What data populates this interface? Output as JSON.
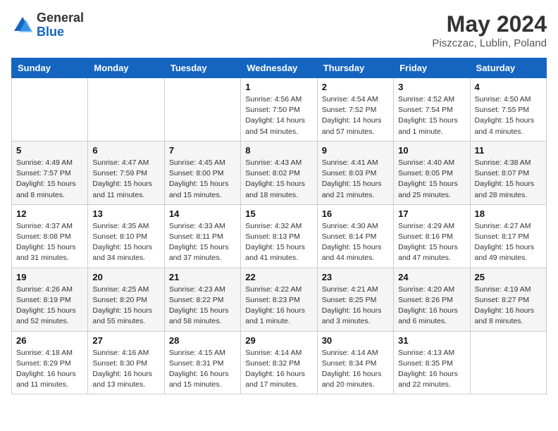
{
  "header": {
    "logo_general": "General",
    "logo_blue": "Blue",
    "month_year": "May 2024",
    "location": "Piszczac, Lublin, Poland"
  },
  "weekdays": [
    "Sunday",
    "Monday",
    "Tuesday",
    "Wednesday",
    "Thursday",
    "Friday",
    "Saturday"
  ],
  "weeks": [
    [
      null,
      null,
      null,
      {
        "day": 1,
        "sunrise": "4:56 AM",
        "sunset": "7:50 PM",
        "daylight": "14 hours and 54 minutes."
      },
      {
        "day": 2,
        "sunrise": "4:54 AM",
        "sunset": "7:52 PM",
        "daylight": "14 hours and 57 minutes."
      },
      {
        "day": 3,
        "sunrise": "4:52 AM",
        "sunset": "7:54 PM",
        "daylight": "15 hours and 1 minute."
      },
      {
        "day": 4,
        "sunrise": "4:50 AM",
        "sunset": "7:55 PM",
        "daylight": "15 hours and 4 minutes."
      }
    ],
    [
      {
        "day": 5,
        "sunrise": "4:49 AM",
        "sunset": "7:57 PM",
        "daylight": "15 hours and 8 minutes."
      },
      {
        "day": 6,
        "sunrise": "4:47 AM",
        "sunset": "7:59 PM",
        "daylight": "15 hours and 11 minutes."
      },
      {
        "day": 7,
        "sunrise": "4:45 AM",
        "sunset": "8:00 PM",
        "daylight": "15 hours and 15 minutes."
      },
      {
        "day": 8,
        "sunrise": "4:43 AM",
        "sunset": "8:02 PM",
        "daylight": "15 hours and 18 minutes."
      },
      {
        "day": 9,
        "sunrise": "4:41 AM",
        "sunset": "8:03 PM",
        "daylight": "15 hours and 21 minutes."
      },
      {
        "day": 10,
        "sunrise": "4:40 AM",
        "sunset": "8:05 PM",
        "daylight": "15 hours and 25 minutes."
      },
      {
        "day": 11,
        "sunrise": "4:38 AM",
        "sunset": "8:07 PM",
        "daylight": "15 hours and 28 minutes."
      }
    ],
    [
      {
        "day": 12,
        "sunrise": "4:37 AM",
        "sunset": "8:08 PM",
        "daylight": "15 hours and 31 minutes."
      },
      {
        "day": 13,
        "sunrise": "4:35 AM",
        "sunset": "8:10 PM",
        "daylight": "15 hours and 34 minutes."
      },
      {
        "day": 14,
        "sunrise": "4:33 AM",
        "sunset": "8:11 PM",
        "daylight": "15 hours and 37 minutes."
      },
      {
        "day": 15,
        "sunrise": "4:32 AM",
        "sunset": "8:13 PM",
        "daylight": "15 hours and 41 minutes."
      },
      {
        "day": 16,
        "sunrise": "4:30 AM",
        "sunset": "8:14 PM",
        "daylight": "15 hours and 44 minutes."
      },
      {
        "day": 17,
        "sunrise": "4:29 AM",
        "sunset": "8:16 PM",
        "daylight": "15 hours and 47 minutes."
      },
      {
        "day": 18,
        "sunrise": "4:27 AM",
        "sunset": "8:17 PM",
        "daylight": "15 hours and 49 minutes."
      }
    ],
    [
      {
        "day": 19,
        "sunrise": "4:26 AM",
        "sunset": "8:19 PM",
        "daylight": "15 hours and 52 minutes."
      },
      {
        "day": 20,
        "sunrise": "4:25 AM",
        "sunset": "8:20 PM",
        "daylight": "15 hours and 55 minutes."
      },
      {
        "day": 21,
        "sunrise": "4:23 AM",
        "sunset": "8:22 PM",
        "daylight": "15 hours and 58 minutes."
      },
      {
        "day": 22,
        "sunrise": "4:22 AM",
        "sunset": "8:23 PM",
        "daylight": "16 hours and 1 minute."
      },
      {
        "day": 23,
        "sunrise": "4:21 AM",
        "sunset": "8:25 PM",
        "daylight": "16 hours and 3 minutes."
      },
      {
        "day": 24,
        "sunrise": "4:20 AM",
        "sunset": "8:26 PM",
        "daylight": "16 hours and 6 minutes."
      },
      {
        "day": 25,
        "sunrise": "4:19 AM",
        "sunset": "8:27 PM",
        "daylight": "16 hours and 8 minutes."
      }
    ],
    [
      {
        "day": 26,
        "sunrise": "4:18 AM",
        "sunset": "8:29 PM",
        "daylight": "16 hours and 11 minutes."
      },
      {
        "day": 27,
        "sunrise": "4:16 AM",
        "sunset": "8:30 PM",
        "daylight": "16 hours and 13 minutes."
      },
      {
        "day": 28,
        "sunrise": "4:15 AM",
        "sunset": "8:31 PM",
        "daylight": "16 hours and 15 minutes."
      },
      {
        "day": 29,
        "sunrise": "4:14 AM",
        "sunset": "8:32 PM",
        "daylight": "16 hours and 17 minutes."
      },
      {
        "day": 30,
        "sunrise": "4:14 AM",
        "sunset": "8:34 PM",
        "daylight": "16 hours and 20 minutes."
      },
      {
        "day": 31,
        "sunrise": "4:13 AM",
        "sunset": "8:35 PM",
        "daylight": "16 hours and 22 minutes."
      },
      null
    ]
  ],
  "labels": {
    "sunrise": "Sunrise:",
    "sunset": "Sunset:",
    "daylight": "Daylight:"
  }
}
